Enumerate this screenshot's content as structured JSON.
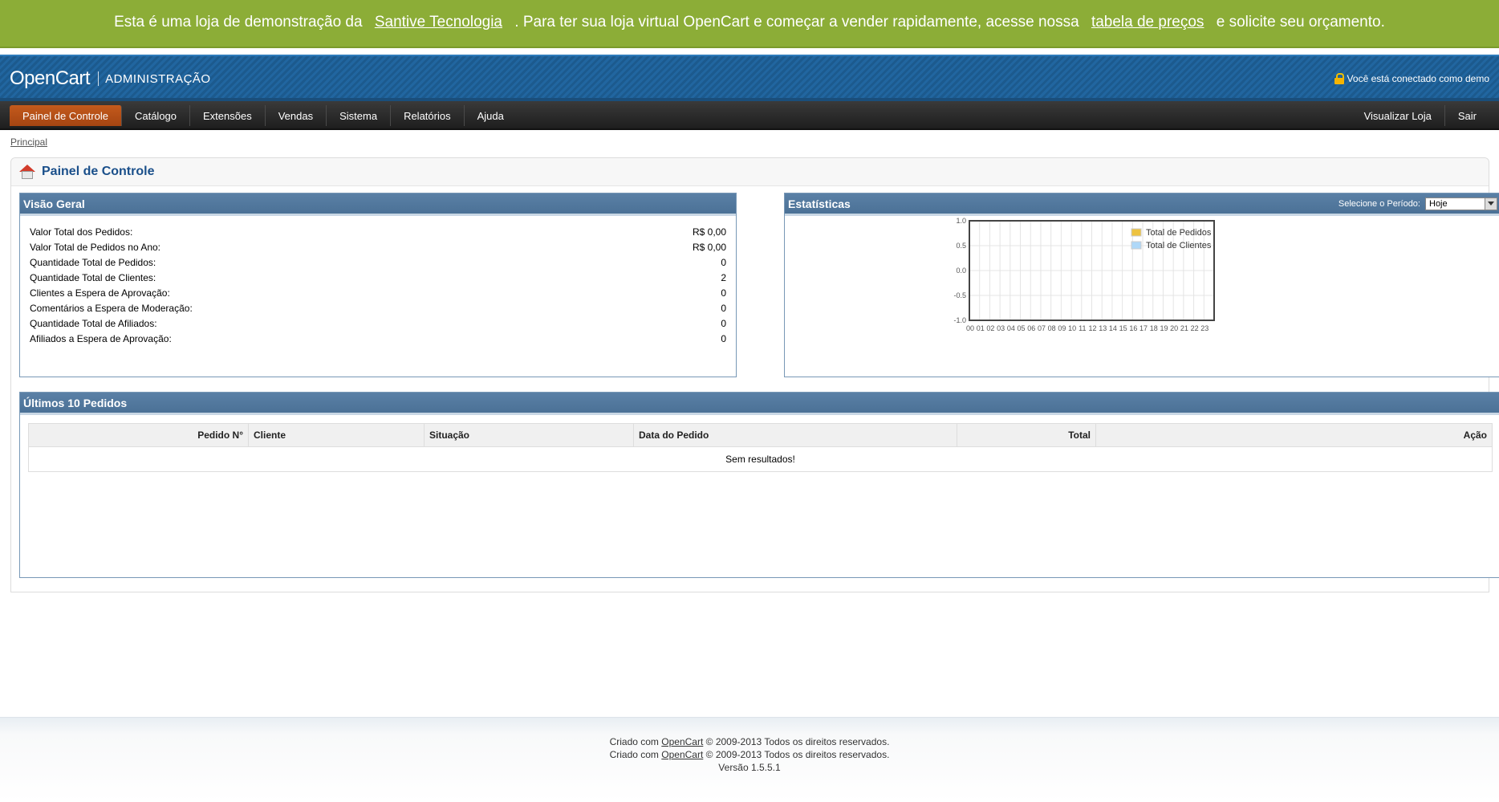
{
  "banner": {
    "text_pre": "Esta é uma loja de demonstração da",
    "link1": "Santive Tecnologia",
    "text_mid": ". Para ter sua loja virtual OpenCart e começar a vender rapidamente, acesse nossa",
    "link2": "tabela de preços",
    "text_post": "e solicite seu orçamento."
  },
  "header": {
    "logo": "OpenCart",
    "subtitle": "ADMINISTRAÇÃO",
    "login_text": "Você está conectado como demo"
  },
  "nav": {
    "items": [
      "Painel de Controle",
      "Catálogo",
      "Extensões",
      "Vendas",
      "Sistema",
      "Relatórios",
      "Ajuda"
    ],
    "right": [
      "Visualizar Loja",
      "Sair"
    ]
  },
  "breadcrumb": "Principal",
  "page_title": "Painel de Controle",
  "overview": {
    "title": "Visão Geral",
    "rows": [
      {
        "label": "Valor Total dos Pedidos:",
        "value": "R$ 0,00"
      },
      {
        "label": "Valor Total de Pedidos no Ano:",
        "value": "R$ 0,00"
      },
      {
        "label": "Quantidade Total de Pedidos:",
        "value": "0"
      },
      {
        "label": "Quantidade Total de Clientes:",
        "value": "2"
      },
      {
        "label": "Clientes a Espera de Aprovação:",
        "value": "0"
      },
      {
        "label": "Comentários a Espera de Moderação:",
        "value": "0"
      },
      {
        "label": "Quantidade Total de Afiliados:",
        "value": "0"
      },
      {
        "label": "Afiliados a Espera de Aprovação:",
        "value": "0"
      }
    ]
  },
  "stats": {
    "title": "Estatísticas",
    "period_label": "Selecione o Período:",
    "period_value": "Hoje"
  },
  "chart_data": {
    "type": "line",
    "x": [
      "00",
      "01",
      "02",
      "03",
      "04",
      "05",
      "06",
      "07",
      "08",
      "09",
      "10",
      "11",
      "12",
      "13",
      "14",
      "15",
      "16",
      "17",
      "18",
      "19",
      "20",
      "21",
      "22",
      "23"
    ],
    "ylim": [
      -1.0,
      1.0
    ],
    "yticks": [
      "1.0",
      "0.5",
      "0.0",
      "-0.5",
      "-1.0"
    ],
    "series": [
      {
        "name": "Total de Pedidos",
        "color": "#edc240",
        "values": []
      },
      {
        "name": "Total de Clientes",
        "color": "#afd8f8",
        "values": []
      }
    ],
    "legend": "top-right",
    "grid": true
  },
  "orders": {
    "title": "Últimos 10 Pedidos",
    "columns": [
      "Pedido N°",
      "Cliente",
      "Situação",
      "Data do Pedido",
      "Total",
      "Ação"
    ],
    "empty": "Sem resultados!"
  },
  "footer": {
    "prefix": "Criado com",
    "link": "OpenCart",
    "suffix": "© 2009-2013 Todos os direitos reservados.",
    "version": "Versão 1.5.5.1"
  }
}
